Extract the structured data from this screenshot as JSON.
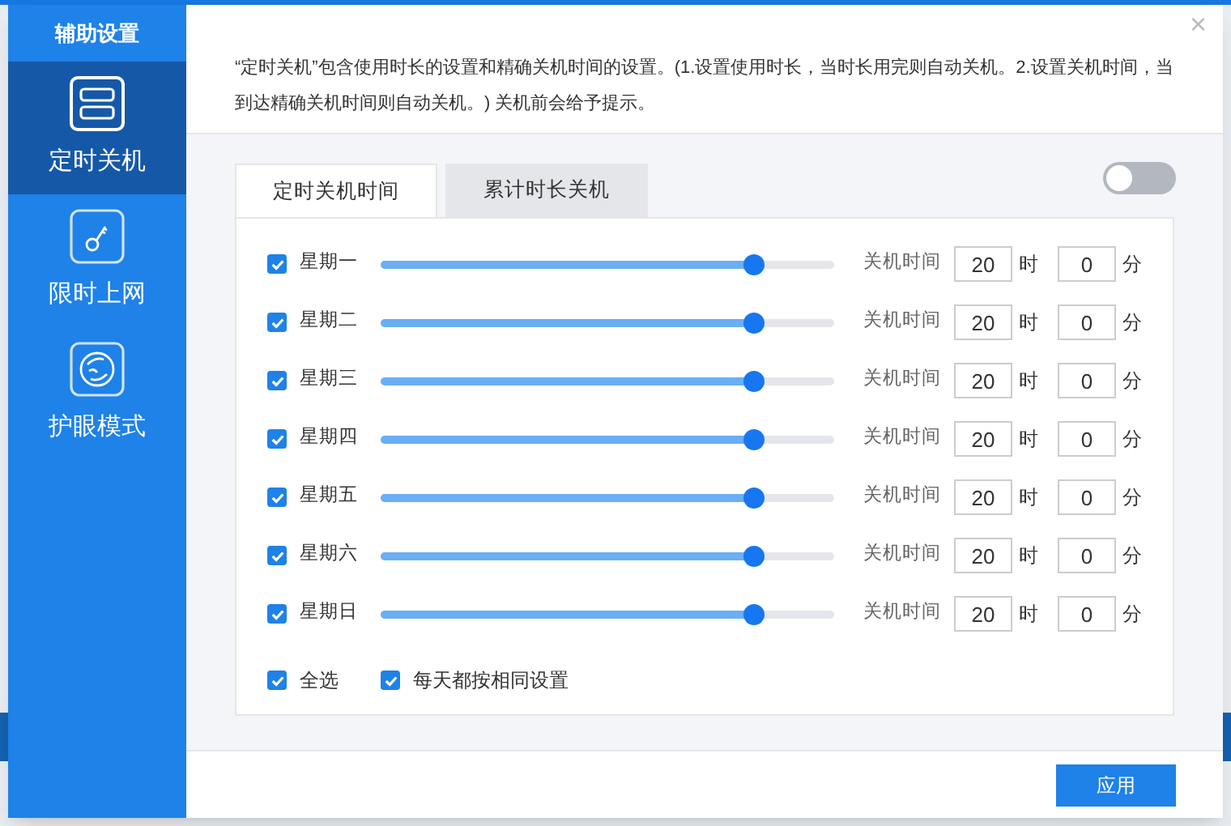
{
  "sidebar": {
    "title": "辅助设置",
    "items": [
      {
        "label": "定时关机",
        "selected": true
      },
      {
        "label": "限时上网",
        "selected": false
      },
      {
        "label": "护眼模式",
        "selected": false
      }
    ]
  },
  "description": "“定时关机”包含使用时长的设置和精确关机时间的设置。(1.设置使用时长，当时长用完则自动关机。2.设置关机时间，当到达精确关机时间则自动关机。) 关机前会给予提示。",
  "close": "×",
  "toggle": {
    "on": false
  },
  "tabs": [
    {
      "label": "定时关机时间",
      "selected": true
    },
    {
      "label": "累计时长关机",
      "selected": false
    }
  ],
  "days": [
    {
      "label": "星期一",
      "checked": true,
      "level": 0.82,
      "time_label": "关机时间",
      "hour": "20",
      "hour_unit": "时",
      "minute": "0",
      "minute_unit": "分"
    },
    {
      "label": "星期二",
      "checked": true,
      "level": 0.82,
      "time_label": "关机时间",
      "hour": "20",
      "hour_unit": "时",
      "minute": "0",
      "minute_unit": "分"
    },
    {
      "label": "星期三",
      "checked": true,
      "level": 0.82,
      "time_label": "关机时间",
      "hour": "20",
      "hour_unit": "时",
      "minute": "0",
      "minute_unit": "分"
    },
    {
      "label": "星期四",
      "checked": true,
      "level": 0.82,
      "time_label": "关机时间",
      "hour": "20",
      "hour_unit": "时",
      "minute": "0",
      "minute_unit": "分"
    },
    {
      "label": "星期五",
      "checked": true,
      "level": 0.82,
      "time_label": "关机时间",
      "hour": "20",
      "hour_unit": "时",
      "minute": "0",
      "minute_unit": "分"
    },
    {
      "label": "星期六",
      "checked": true,
      "level": 0.82,
      "time_label": "关机时间",
      "hour": "20",
      "hour_unit": "时",
      "minute": "0",
      "minute_unit": "分"
    },
    {
      "label": "星期日",
      "checked": true,
      "level": 0.82,
      "time_label": "关机时间",
      "hour": "20",
      "hour_unit": "时",
      "minute": "0",
      "minute_unit": "分"
    }
  ],
  "options": [
    {
      "label": "全选",
      "checked": true
    },
    {
      "label": "每天都按相同设置",
      "checked": true
    }
  ],
  "apply_button": "应用"
}
